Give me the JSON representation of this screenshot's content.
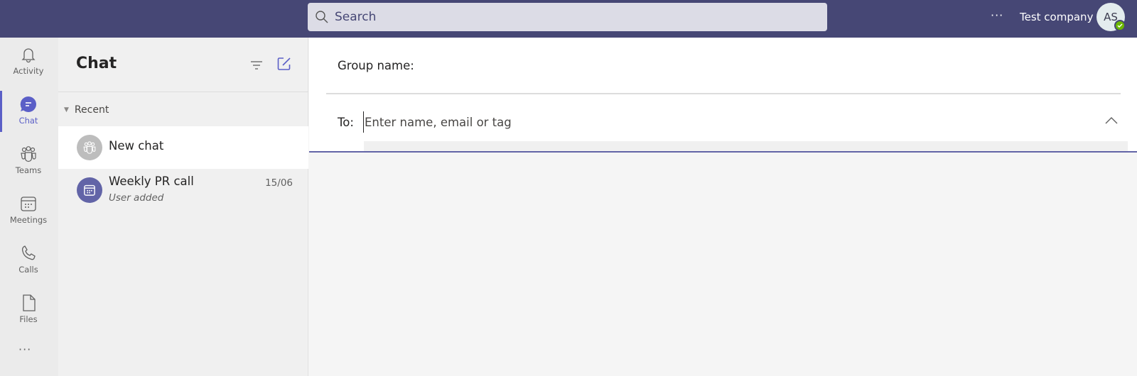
{
  "topbar": {
    "search_placeholder": "Search",
    "more_label": "···",
    "company": "Test company",
    "avatar_initials": "AS",
    "status": "available",
    "colors": {
      "bar": "#464775",
      "search_bg": "#dcdce6",
      "status": "#6bb700"
    }
  },
  "rail": {
    "items": [
      {
        "label": "Activity",
        "icon": "bell-icon"
      },
      {
        "label": "Chat",
        "icon": "chat-icon",
        "active": true
      },
      {
        "label": "Teams",
        "icon": "teams-icon"
      },
      {
        "label": "Meetings",
        "icon": "calendar-icon"
      },
      {
        "label": "Calls",
        "icon": "phone-icon"
      },
      {
        "label": "Files",
        "icon": "file-icon"
      }
    ],
    "more_label": "···",
    "accent": "#5b5fc7"
  },
  "chat_list": {
    "title": "Chat",
    "section": "Recent",
    "items": [
      {
        "name": "New chat",
        "selected": true
      },
      {
        "name": "Weekly PR call",
        "subtitle": "User added",
        "date": "15/06"
      }
    ]
  },
  "compose": {
    "group_name_label": "Group name:",
    "to_label": "To:",
    "to_placeholder": "Enter name, email or tag",
    "to_value": ""
  }
}
